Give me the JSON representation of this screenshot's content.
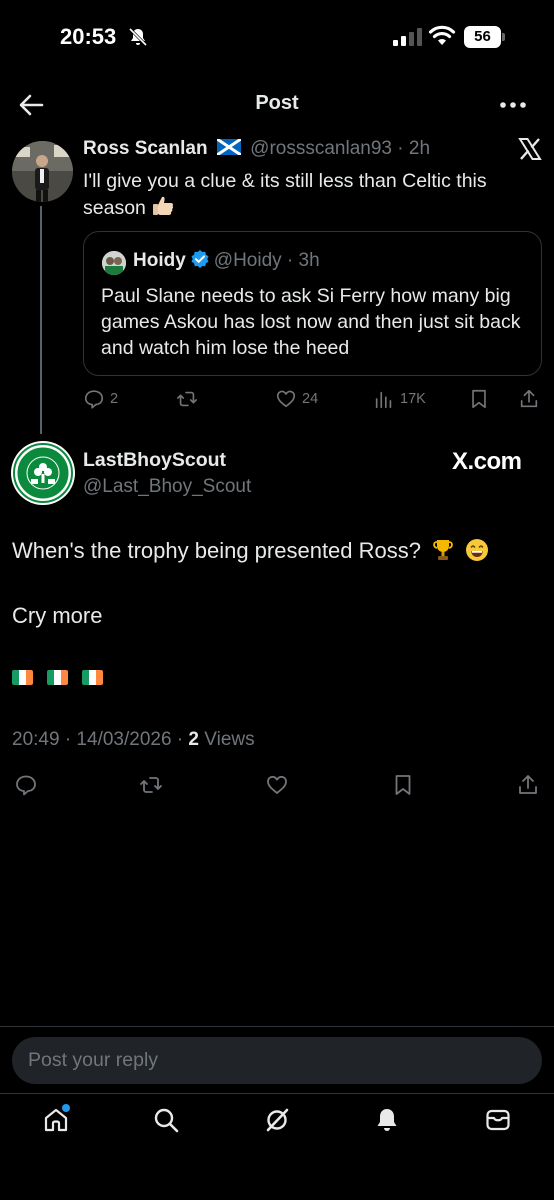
{
  "status_bar": {
    "time": "20:53",
    "battery": "56"
  },
  "header": {
    "title": "Post"
  },
  "parent_tweet": {
    "name": "Ross Scanlan",
    "handle": "@rossscanlan93",
    "time": "2h",
    "text": "I'll give you a clue & its still less than Celtic this season",
    "quote": {
      "name": "Hoidy",
      "handle": "@Hoidy",
      "time": "3h",
      "text": "Paul Slane needs to ask Si Ferry how many big games Askou has lost now and then just sit back and watch him lose the heed"
    },
    "actions": {
      "replies": "2",
      "likes": "24",
      "views": "17K"
    }
  },
  "main_tweet": {
    "name": "LastBhoyScout",
    "handle": "@Last_Bhoy_Scout",
    "source_badge": "X.com",
    "line1": "When's the trophy being presented Ross?",
    "line2": "Cry more",
    "date": "20:49 · 14/03/2026 ·",
    "views_count": "2",
    "views_label": "Views"
  },
  "reply": {
    "placeholder": "Post your reply"
  },
  "colors": {
    "accent": "#1d9bf0",
    "muted": "#71767b",
    "text": "#e7e9ea",
    "celtic_green": "#0b8a3e"
  }
}
